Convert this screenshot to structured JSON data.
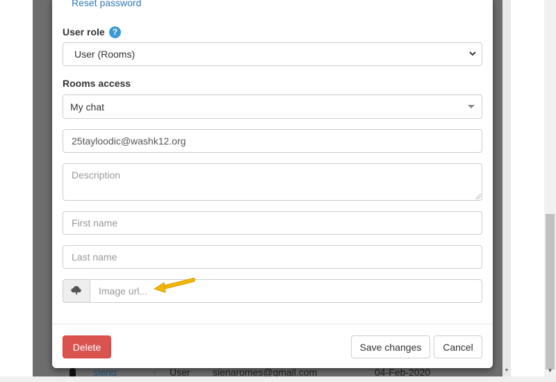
{
  "modal": {
    "reset_password_link": "Reset password",
    "user_role": {
      "label": "User role",
      "help_icon": "?",
      "selected": "User (Rooms)"
    },
    "rooms_access": {
      "label": "Rooms access",
      "selected": "My chat"
    },
    "email_value": "25tayloodic@washk12.org",
    "description_placeholder": "Description",
    "first_name_placeholder": "First name",
    "last_name_placeholder": "Last name",
    "image_url_placeholder": "Image url...",
    "buttons": {
      "delete": "Delete",
      "save": "Save changes",
      "cancel": "Cancel"
    }
  },
  "background_row": {
    "name": "sieng",
    "chevron": "›",
    "role": "User",
    "email": "sienaromes@gmail.com",
    "date": "04-Feb-2020"
  },
  "icons": {
    "help": "question-circle-icon",
    "select_chevron": "chevron-down-icon",
    "combo_caret": "caret-down-icon",
    "upload": "cloud-upload-icon",
    "annotation_arrow": "arrow-left-icon"
  },
  "colors": {
    "danger": "#d9534f",
    "link": "#337ab7",
    "help_badge": "#3a9ad9",
    "annotation_arrow": "#f2b705",
    "backdrop": "#6d6d6d"
  }
}
